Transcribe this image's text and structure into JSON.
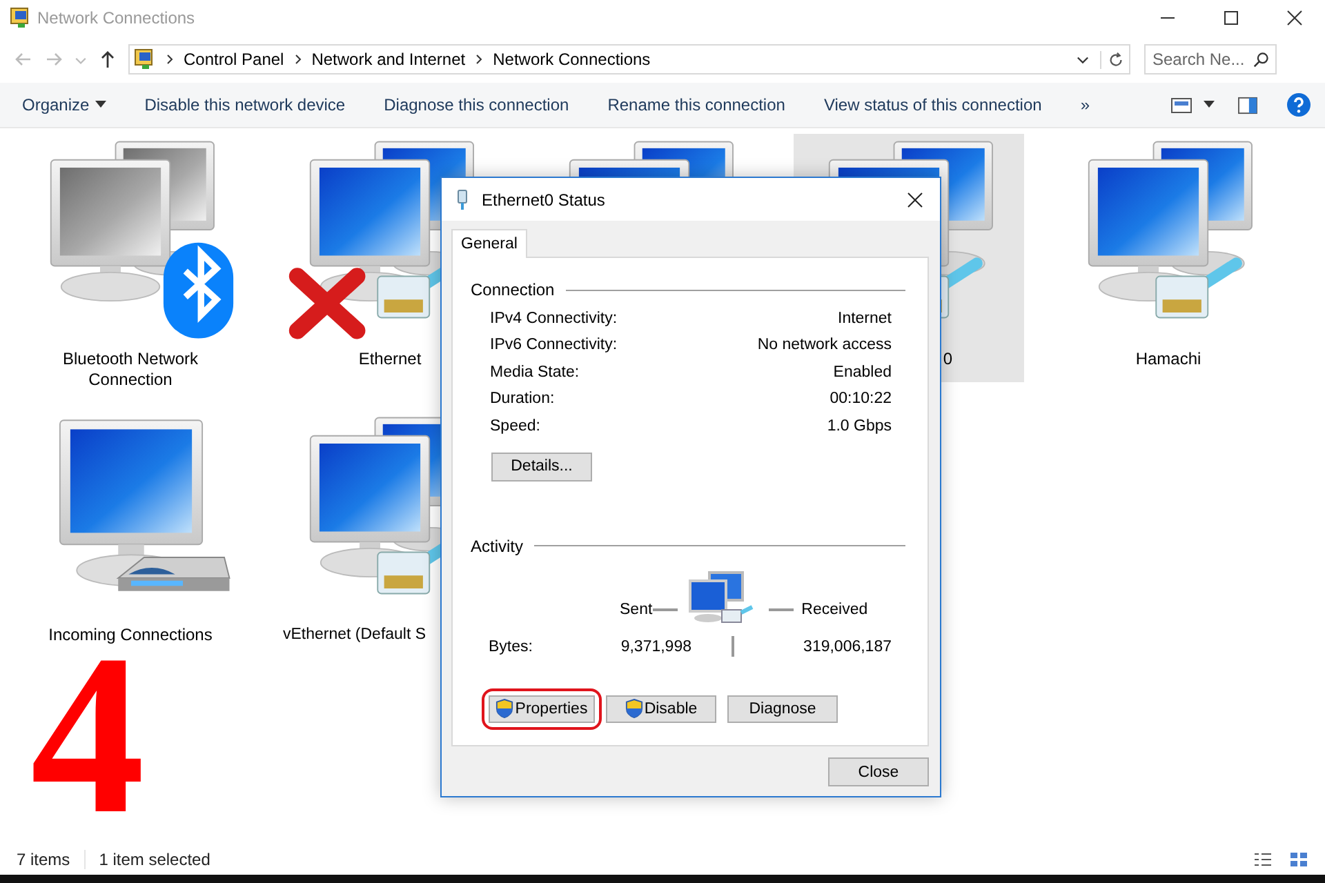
{
  "window": {
    "title": "Network Connections"
  },
  "address_bar": {
    "path": [
      "Control Panel",
      "Network and Internet",
      "Network Connections"
    ]
  },
  "search": {
    "placeholder": "Search Ne..."
  },
  "toolbar": {
    "items": [
      {
        "label": "Organize",
        "kind": "menu"
      },
      {
        "label": "Disable this network device",
        "kind": "command"
      },
      {
        "label": "Diagnose this connection",
        "kind": "command"
      },
      {
        "label": "Rename this connection",
        "kind": "command"
      },
      {
        "label": "View status of this connection",
        "kind": "command"
      }
    ],
    "overflow": "»"
  },
  "connections": [
    {
      "kind": "pair",
      "disabled": true,
      "bluetooth": true,
      "error": false,
      "plug": false,
      "modem": false,
      "label": "Bluetooth Network Connection",
      "label_cut_left": false,
      "label_cut_right": false,
      "selected": false
    },
    {
      "kind": "pair",
      "disabled": false,
      "bluetooth": false,
      "error": true,
      "plug": true,
      "modem": false,
      "label": "Ethernet",
      "label_cut_left": false,
      "label_cut_right": false,
      "selected": false
    },
    {
      "kind": "pair",
      "disabled": false,
      "selected": false
    },
    {
      "kind": "pair",
      "disabled": false,
      "bluetooth": false,
      "error": false,
      "plug": true,
      "modem": false,
      "label": "0",
      "label_cut_left": true,
      "label_cut_right": false,
      "selected": true
    },
    {
      "kind": "pair",
      "disabled": false,
      "bluetooth": false,
      "error": false,
      "plug": true,
      "modem": false,
      "label": "Hamachi",
      "label_cut_left": false,
      "label_cut_right": false,
      "selected": false
    },
    {
      "kind": "single",
      "disabled": false,
      "bluetooth": false,
      "error": false,
      "plug": false,
      "modem": true,
      "label": "Incoming Connections",
      "label_cut_left": false,
      "label_cut_right": false,
      "selected": false
    },
    {
      "kind": "pair",
      "disabled": false,
      "bluetooth": false,
      "error": false,
      "plug": true,
      "modem": false,
      "label": "vEthernet (Default S",
      "label_cut_left": false,
      "label_cut_right": true,
      "selected": false
    }
  ],
  "annotation": {
    "step": "4"
  },
  "dialog": {
    "title": "Ethernet0 Status",
    "tabs": [
      {
        "label": "General",
        "selected": true
      }
    ],
    "connection": {
      "heading": "Connection",
      "rows": [
        {
          "label": "IPv4 Connectivity:",
          "value": "Internet"
        },
        {
          "label": "IPv6 Connectivity:",
          "value": "No network access"
        },
        {
          "label": "Media State:",
          "value": "Enabled"
        },
        {
          "label": "Duration:",
          "value": "00:10:22"
        },
        {
          "label": "Speed:",
          "value": "1.0 Gbps"
        }
      ],
      "details_button": "Details..."
    },
    "activity": {
      "heading": "Activity",
      "sent_label": "Sent",
      "received_label": "Received",
      "bytes_label": "Bytes:",
      "sent": "9,371,998",
      "received": "319,006,187"
    },
    "buttons": [
      {
        "label": "Properties",
        "shield": true,
        "highlighted": true
      },
      {
        "label": "Disable",
        "shield": true,
        "highlighted": false
      },
      {
        "label": "Diagnose",
        "shield": false,
        "highlighted": false
      }
    ],
    "close_button": "Close"
  },
  "status_bar": {
    "item_count": "7 items",
    "selection": "1 item selected"
  }
}
